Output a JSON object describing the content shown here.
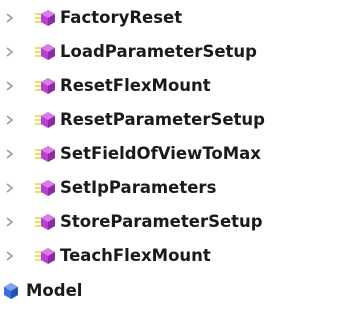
{
  "tree": {
    "method_nodes": [
      {
        "label": "FactoryReset",
        "icon": "method-icon",
        "expander_icon": "chevron-right-icon"
      },
      {
        "label": "LoadParameterSetup",
        "icon": "method-icon",
        "expander_icon": "chevron-right-icon"
      },
      {
        "label": "ResetFlexMount",
        "icon": "method-icon",
        "expander_icon": "chevron-right-icon"
      },
      {
        "label": "ResetParameterSetup",
        "icon": "method-icon",
        "expander_icon": "chevron-right-icon"
      },
      {
        "label": "SetFieldOfViewToMax",
        "icon": "method-icon",
        "expander_icon": "chevron-right-icon"
      },
      {
        "label": "SetIpParameters",
        "icon": "method-icon",
        "expander_icon": "chevron-right-icon"
      },
      {
        "label": "StoreParameterSetup",
        "icon": "method-icon",
        "expander_icon": "chevron-right-icon"
      },
      {
        "label": "TeachFlexMount",
        "icon": "method-icon",
        "expander_icon": "chevron-right-icon"
      }
    ],
    "model_node": {
      "label": "Model",
      "icon": "model-icon"
    }
  },
  "colors": {
    "method_icon_fill": "#b83fd0",
    "method_icon_lines": "#e8e04a",
    "model_icon_fill": "#3a6fd8",
    "expander": "#9a9a9a",
    "text": "#1a1a1a"
  }
}
